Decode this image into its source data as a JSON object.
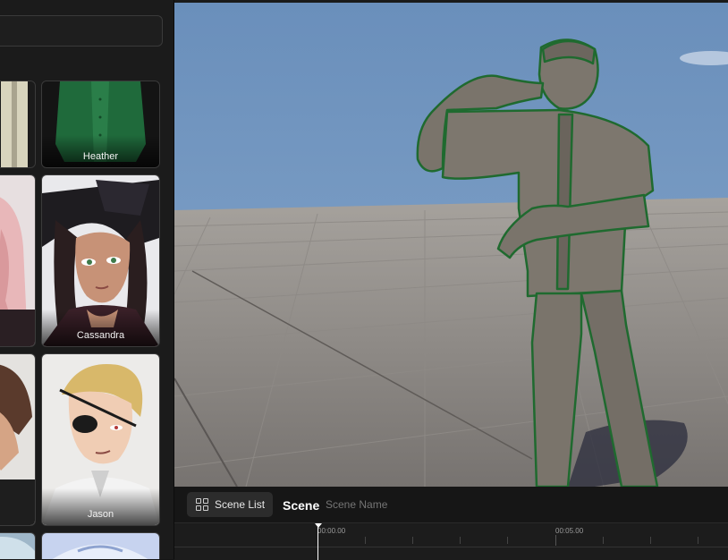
{
  "characters": [
    {
      "name": "Heather"
    },
    {
      "name": "Cassandra"
    },
    {
      "name": "Jason"
    }
  ],
  "scene_bar": {
    "scene_list_label": "Scene List",
    "scene_title": "Scene",
    "scene_name_placeholder": "Scene Name"
  },
  "timeline": {
    "timestamps": [
      "00:00.00",
      "00:05.00"
    ]
  }
}
